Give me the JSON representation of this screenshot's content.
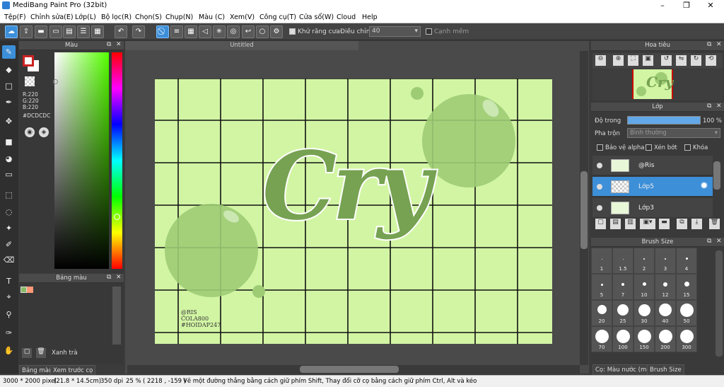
{
  "app": {
    "title": "MediBang Paint Pro (32bit)"
  },
  "menu": [
    "Tệp(F)",
    "Chỉnh sửa(E)",
    "Lớp(L)",
    "Bộ lọc(R)",
    "Chọn(S)",
    "Chụp(N)",
    "Màu (C)",
    "Xem(V)",
    "Công cụ(T)",
    "Cửa sổ(W)",
    "Cloud",
    "Help"
  ],
  "toolbar": {
    "antialias_label": "Khử răng cưa",
    "adjust_label": "Điều chỉnh",
    "adjust_value": "40",
    "edge_label": "Cạnh mềm"
  },
  "color_panel": {
    "title": "Màu",
    "r": "R:220",
    "g": "G:220",
    "b": "B:220",
    "hex": "#DCDCDC",
    "fg_color": "#cc2222",
    "bg_color": "#ffffff"
  },
  "palette_panel": {
    "title": "Bảng màu",
    "color_name": "Xanh trà",
    "swatches": [
      "#88bb66",
      "#ff9977"
    ],
    "tab_palette": "Bảng màu",
    "tab_preview": "Xem trước cọ"
  },
  "canvas": {
    "tab_title": "Untitled",
    "bg_color": "#d2f5a4",
    "art_text": "Cry",
    "credit_lines": [
      "@RIS",
      "COLA800",
      "#HOIDAP247"
    ]
  },
  "navigator": {
    "title": "Hoa tiêu"
  },
  "layers": {
    "title": "Lớp",
    "opacity_label": "Độ trong",
    "opacity_value": "100 %",
    "blend_label": "Pha trộn",
    "blend_value": "Bình thường",
    "protect_alpha": "Bảo vệ alpha",
    "clip": "Xén bớt",
    "lock": "Khóa",
    "items": [
      {
        "name": "@Ris",
        "selected": false
      },
      {
        "name": "Lớp5",
        "selected": true
      },
      {
        "name": "Lớp3",
        "selected": false
      }
    ]
  },
  "brush_size": {
    "title": "Brush Size",
    "sizes": [
      "1",
      "1.5",
      "2",
      "3",
      "4",
      "5",
      "7",
      "10",
      "12",
      "15",
      "20",
      "25",
      "30",
      "40",
      "50",
      "70",
      "100",
      "150",
      "200",
      "300"
    ],
    "tab_watercolor": "Cọ: Màu nước (mờ)",
    "tab_brushsize": "Brush Size"
  },
  "status": {
    "size": "3000 * 2000 pixel",
    "cm": "(21.8 * 14.5cm)",
    "dpi": "350 dpi",
    "zoom": "25 %",
    "coords": "( 2218 , -159 )",
    "hint": "Vẽ một đường thẳng bằng cách giữ phím Shift, Thay đổi cỡ cọ bằng cách giữ phím Ctrl, Alt và kéo"
  }
}
